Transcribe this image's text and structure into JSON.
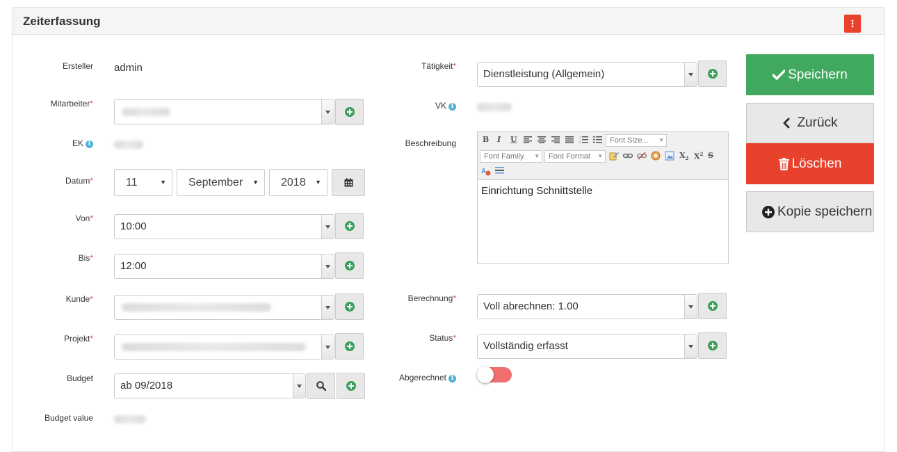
{
  "panel": {
    "title": "Zeiterfassung"
  },
  "left": {
    "ersteller_label": "Ersteller",
    "ersteller_value": "admin",
    "mitarbeiter_label": "Mitarbeiter",
    "ek_label": "EK",
    "datum_label": "Datum",
    "datum_day": "11",
    "datum_month": "September",
    "datum_year": "2018",
    "von_label": "Von",
    "von_value": "10:00",
    "bis_label": "Bis",
    "bis_value": "12:00",
    "kunde_label": "Kunde",
    "projekt_label": "Projekt",
    "budget_label": "Budget",
    "budget_value": "ab 09/2018",
    "budget_value_label": "Budget value"
  },
  "middle": {
    "taetigkeit_label": "Tätigkeit",
    "taetigkeit_value": "Dienstleistung (Allgemein)",
    "vk_label": "VK",
    "beschreibung_label": "Beschreibung",
    "editor": {
      "font_size": "Font Size...",
      "font_family": "Font Family.",
      "font_format": "Font Format",
      "content": "Einrichtung Schnittstelle"
    },
    "berechnung_label": "Berechnung",
    "berechnung_value": "Voll abrechnen: 1.00",
    "status_label": "Status",
    "status_value": "Vollständig erfasst",
    "abgerechnet_label": "Abgerechnet",
    "abgerechnet_on": false
  },
  "required_mark": "*",
  "info_glyph": "i",
  "actions": {
    "save": "Speichern",
    "back": "Zurück",
    "delete": "Löschen",
    "copy_save": "Kopie speichern"
  },
  "colors": {
    "save": "#41a85f",
    "delete": "#e8412c",
    "neutral": "#e8e8e8",
    "plus": "#3c9e5b",
    "info": "#4fb1d8",
    "toggle_off": "#f06e6e"
  }
}
